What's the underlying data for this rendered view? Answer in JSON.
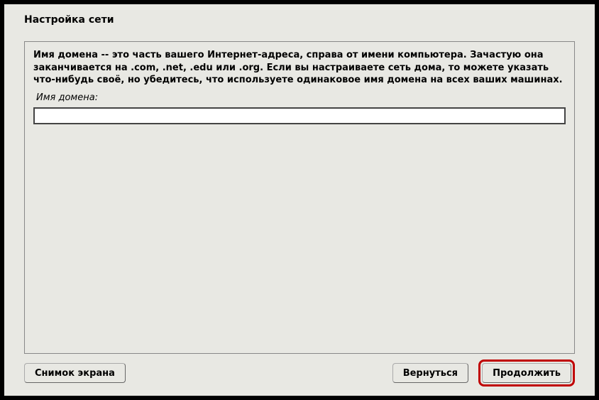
{
  "window": {
    "title": "Настройка сети"
  },
  "main": {
    "description": "Имя домена -- это часть вашего Интернет-адреса, справа от имени компьютера. Зачастую она заканчивается на .com, .net, .edu или .org. Если вы настраиваете сеть дома, то можете указать что-нибудь своё, но убедитесь, что используете одинаковое имя домена на всех ваших машинах.",
    "field_label": "Имя домена:",
    "domain_value": ""
  },
  "buttons": {
    "screenshot": "Снимок экрана",
    "back": "Вернуться",
    "continue": "Продолжить"
  }
}
